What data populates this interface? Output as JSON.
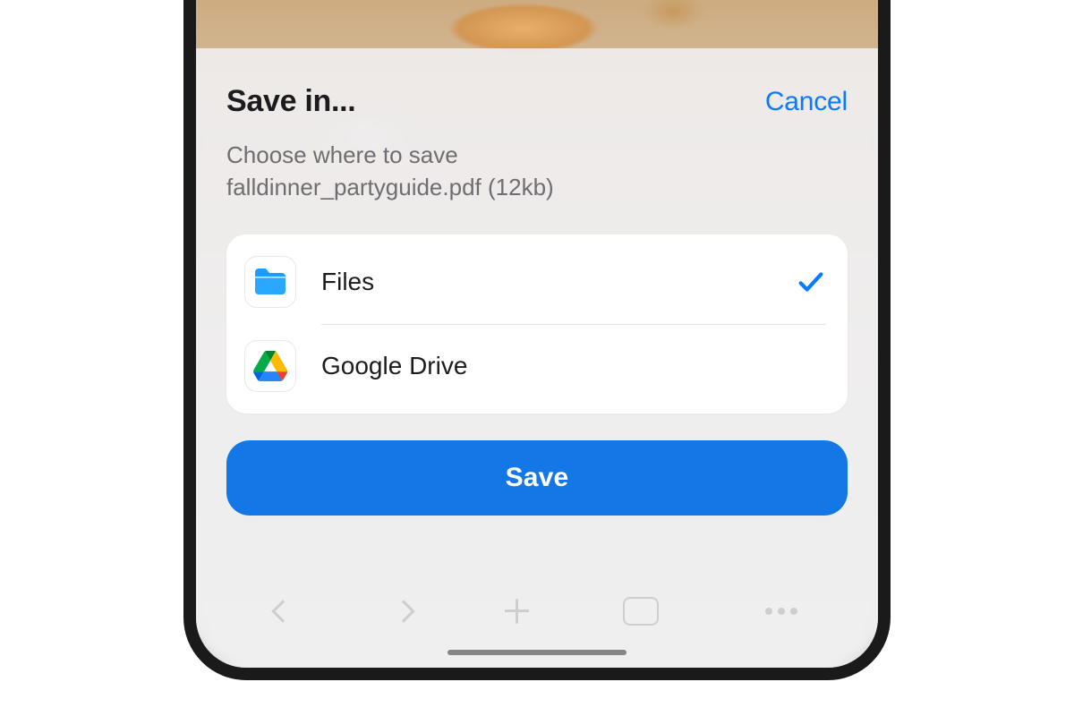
{
  "sheet": {
    "title": "Save in...",
    "cancel": "Cancel",
    "subtitle_prefix": "Choose where to save",
    "file_name": "falldinner_partyguide.pdf",
    "file_size": "(12kb)"
  },
  "options": [
    {
      "label": "Files",
      "icon": "files-icon",
      "selected": true
    },
    {
      "label": "Google Drive",
      "icon": "google-drive-icon",
      "selected": false
    }
  ],
  "actions": {
    "save": "Save"
  }
}
